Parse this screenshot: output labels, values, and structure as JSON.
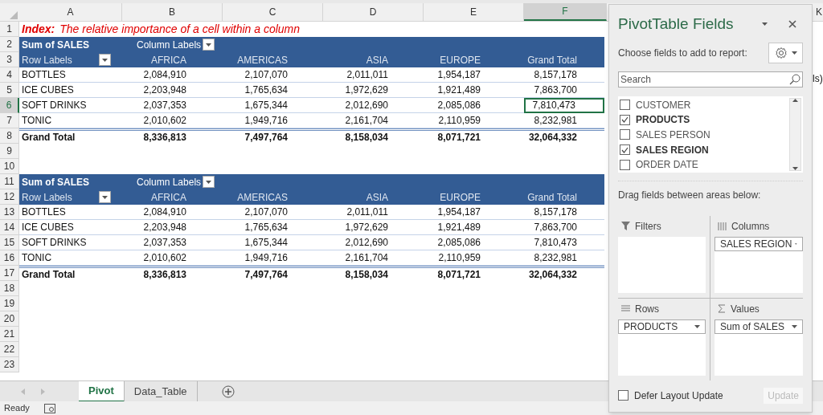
{
  "column_headers": [
    {
      "label": "A",
      "selected": false
    },
    {
      "label": "B",
      "selected": false
    },
    {
      "label": "C",
      "selected": false
    },
    {
      "label": "D",
      "selected": false
    },
    {
      "label": "E",
      "selected": false
    },
    {
      "label": "F",
      "selected": true
    }
  ],
  "row_numbers": [
    {
      "label": "1",
      "selected": false
    },
    {
      "label": "2",
      "selected": false
    },
    {
      "label": "3",
      "selected": false
    },
    {
      "label": "4",
      "selected": false
    },
    {
      "label": "5",
      "selected": false
    },
    {
      "label": "6",
      "selected": true
    },
    {
      "label": "7",
      "selected": false
    },
    {
      "label": "8",
      "selected": false
    },
    {
      "label": "9",
      "selected": false
    },
    {
      "label": "10",
      "selected": false
    },
    {
      "label": "11",
      "selected": false
    },
    {
      "label": "12",
      "selected": false
    },
    {
      "label": "13",
      "selected": false
    },
    {
      "label": "14",
      "selected": false
    },
    {
      "label": "15",
      "selected": false
    },
    {
      "label": "16",
      "selected": false
    },
    {
      "label": "17",
      "selected": false
    },
    {
      "label": "18",
      "selected": false
    },
    {
      "label": "19",
      "selected": false
    },
    {
      "label": "20",
      "selected": false
    },
    {
      "label": "21",
      "selected": false
    },
    {
      "label": "22",
      "selected": false
    },
    {
      "label": "23",
      "selected": false
    }
  ],
  "title": {
    "label": "Index:",
    "text": "The relative importance of a cell within a column"
  },
  "pivots": [
    {
      "value_label": "Sum of SALES",
      "column_labels": "Column Labels",
      "row_labels": "Row Labels",
      "columns": [
        "AFRICA",
        "AMERICAS",
        "ASIA",
        "EUROPE",
        "Grand Total"
      ],
      "rows": [
        {
          "label": "BOTTLES",
          "cells": [
            {
              "text": "2,084,910",
              "selected": false
            },
            {
              "text": "2,107,070",
              "selected": false
            },
            {
              "text": "2,011,011",
              "selected": false
            },
            {
              "text": "1,954,187",
              "selected": false
            },
            {
              "text": "8,157,178",
              "selected": false
            }
          ]
        },
        {
          "label": "ICE CUBES",
          "cells": [
            {
              "text": "2,203,948",
              "selected": false
            },
            {
              "text": "1,765,634",
              "selected": false
            },
            {
              "text": "1,972,629",
              "selected": false
            },
            {
              "text": "1,921,489",
              "selected": false
            },
            {
              "text": "7,863,700",
              "selected": false
            }
          ]
        },
        {
          "label": "SOFT DRINKS",
          "cells": [
            {
              "text": "2,037,353",
              "selected": false
            },
            {
              "text": "1,675,344",
              "selected": false
            },
            {
              "text": "2,012,690",
              "selected": false
            },
            {
              "text": "2,085,086",
              "selected": false
            },
            {
              "text": "7,810,473",
              "selected": true
            }
          ]
        },
        {
          "label": "TONIC",
          "cells": [
            {
              "text": "2,010,602",
              "selected": false
            },
            {
              "text": "1,949,716",
              "selected": false
            },
            {
              "text": "2,161,704",
              "selected": false
            },
            {
              "text": "2,110,959",
              "selected": false
            },
            {
              "text": "8,232,981",
              "selected": false
            }
          ]
        }
      ],
      "total": {
        "label": "Grand Total",
        "values": [
          "8,336,813",
          "7,497,764",
          "8,158,034",
          "8,071,721",
          "32,064,332"
        ]
      }
    },
    {
      "value_label": "Sum of SALES",
      "column_labels": "Column Labels",
      "row_labels": "Row Labels",
      "columns": [
        "AFRICA",
        "AMERICAS",
        "ASIA",
        "EUROPE",
        "Grand Total"
      ],
      "rows": [
        {
          "label": "BOTTLES",
          "cells": [
            {
              "text": "2,084,910",
              "selected": false
            },
            {
              "text": "2,107,070",
              "selected": false
            },
            {
              "text": "2,011,011",
              "selected": false
            },
            {
              "text": "1,954,187",
              "selected": false
            },
            {
              "text": "8,157,178",
              "selected": false
            }
          ]
        },
        {
          "label": "ICE CUBES",
          "cells": [
            {
              "text": "2,203,948",
              "selected": false
            },
            {
              "text": "1,765,634",
              "selected": false
            },
            {
              "text": "1,972,629",
              "selected": false
            },
            {
              "text": "1,921,489",
              "selected": false
            },
            {
              "text": "7,863,700",
              "selected": false
            }
          ]
        },
        {
          "label": "SOFT DRINKS",
          "cells": [
            {
              "text": "2,037,353",
              "selected": false
            },
            {
              "text": "1,675,344",
              "selected": false
            },
            {
              "text": "2,012,690",
              "selected": false
            },
            {
              "text": "2,085,086",
              "selected": false
            },
            {
              "text": "7,810,473",
              "selected": false
            }
          ]
        },
        {
          "label": "TONIC",
          "cells": [
            {
              "text": "2,010,602",
              "selected": false
            },
            {
              "text": "1,949,716",
              "selected": false
            },
            {
              "text": "2,161,704",
              "selected": false
            },
            {
              "text": "2,110,959",
              "selected": false
            },
            {
              "text": "8,232,981",
              "selected": false
            }
          ]
        }
      ],
      "total": {
        "label": "Grand Total",
        "values": [
          "8,336,813",
          "7,497,764",
          "8,158,034",
          "8,071,721",
          "32,064,332"
        ]
      }
    }
  ],
  "offscreen_right": {
    "column_header": "K",
    "cell_text": "ls)"
  },
  "sheet_tabs": [
    {
      "label": "Pivot",
      "selected": true
    },
    {
      "label": "Data_Table",
      "selected": false
    }
  ],
  "status_bar": {
    "text": "Ready"
  },
  "panel": {
    "title": "PivotTable Fields",
    "subtitle": "Choose fields to add to report:",
    "search": {
      "placeholder": "Search"
    },
    "fields": [
      {
        "label": "CUSTOMER",
        "checked": false
      },
      {
        "label": "PRODUCTS",
        "checked": true
      },
      {
        "label": "SALES PERSON",
        "checked": false
      },
      {
        "label": "SALES REGION",
        "checked": true
      },
      {
        "label": "ORDER DATE",
        "checked": false
      }
    ],
    "drag_hint": "Drag fields between areas below:",
    "areas": [
      {
        "kind": "filters",
        "label": "Filters"
      },
      {
        "kind": "columns",
        "label": "Columns",
        "items": [
          "SALES REGION"
        ]
      },
      {
        "kind": "rows",
        "label": "Rows",
        "items": [
          "PRODUCTS"
        ]
      },
      {
        "kind": "values",
        "label": "Values",
        "items": [
          "Sum of SALES"
        ]
      }
    ],
    "defer": {
      "label": "Defer Layout Update",
      "checked": false
    },
    "update_button": {
      "label": "Update",
      "disabled": true
    }
  }
}
